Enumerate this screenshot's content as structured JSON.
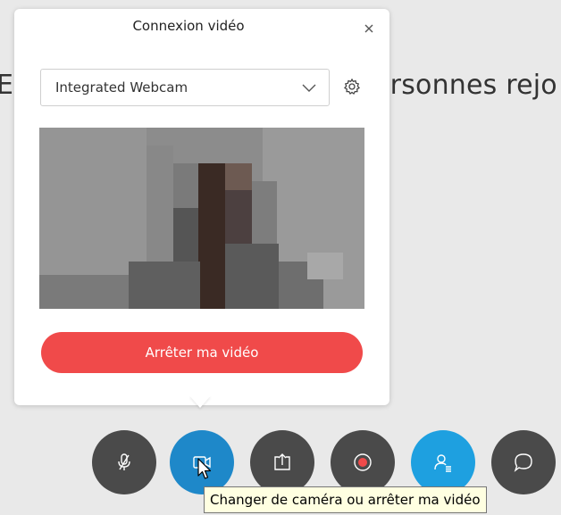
{
  "background": {
    "text_left": "E",
    "text_right": "ersonnes rejo"
  },
  "dialog": {
    "title": "Connexion vidéo",
    "close_icon": "close-icon",
    "camera_select": {
      "value": "Integrated Webcam",
      "icon": "chevron-down-icon"
    },
    "settings_icon": "gear-icon",
    "stop_button_label": "Arrêter ma vidéo",
    "stop_button_color": "#f04a4a"
  },
  "toolbar": {
    "buttons": [
      {
        "name": "mute-button",
        "icon": "microphone-muted-icon",
        "color": "#4a4a4a"
      },
      {
        "name": "video-button",
        "icon": "video-camera-icon",
        "color": "#1e88c9"
      },
      {
        "name": "share-button",
        "icon": "share-upload-icon",
        "color": "#4a4a4a"
      },
      {
        "name": "record-button",
        "icon": "record-icon",
        "color": "#4a4a4a"
      },
      {
        "name": "participants-button",
        "icon": "participants-icon",
        "color": "#1ea0e0"
      },
      {
        "name": "chat-button",
        "icon": "chat-bubble-icon",
        "color": "#4a4a4a"
      }
    ]
  },
  "tooltip": {
    "text": "Changer de caméra ou arrêter ma vidéo"
  }
}
